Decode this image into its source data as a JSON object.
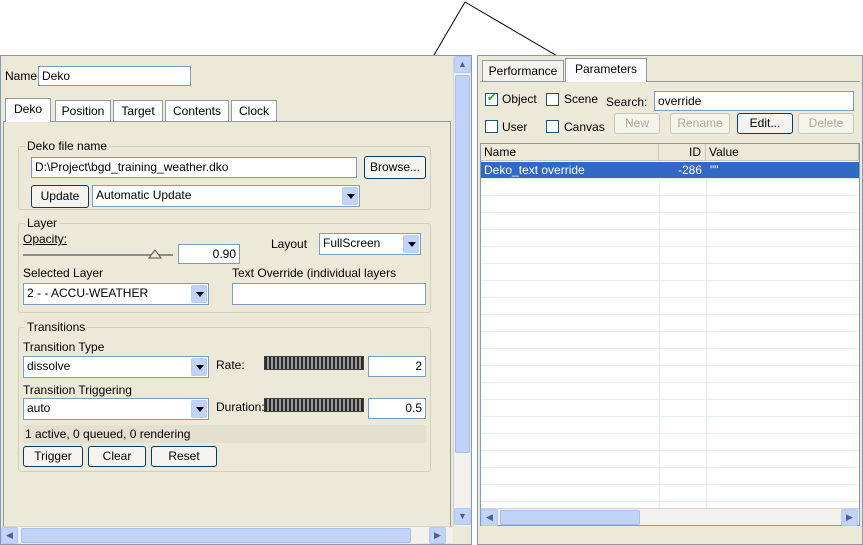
{
  "left": {
    "name_label": "Name:",
    "name_value": "Deko",
    "tabs": [
      "Deko",
      "Position",
      "Target",
      "Contents",
      "Clock"
    ],
    "file_group": {
      "title": "Deko file name",
      "path": "D:\\Project\\bgd_training_weather.dko",
      "browse_label": "Browse...",
      "update_label": "Update",
      "update_mode": "Automatic Update"
    },
    "layer_group": {
      "title": "Layer",
      "opacity_label": "Opacity:",
      "opacity_value": "0.90",
      "layout_label": "Layout",
      "layout_value": "FullScreen",
      "selected_layer_label": "Selected Layer",
      "selected_layer_value": "2 -  - ACCU-WEATHER",
      "text_override_label": "Text Override (individual layers",
      "text_override_value": ""
    },
    "transitions_group": {
      "title": "Transitions",
      "type_label": "Transition Type",
      "type_value": "dissolve",
      "rate_label": "Rate:",
      "rate_value": "2",
      "triggering_label": "Transition Triggering",
      "triggering_value": "auto",
      "duration_label": "Duration:",
      "duration_value": "0.5",
      "status": "1 active, 0 queued, 0 rendering",
      "trigger_label": "Trigger",
      "clear_label": "Clear",
      "reset_label": "Reset"
    }
  },
  "right": {
    "tabs": [
      "Performance",
      "Parameters"
    ],
    "filters": {
      "object_label": "Object",
      "object_checked": true,
      "scene_label": "Scene",
      "scene_checked": false,
      "user_label": "User",
      "user_checked": false,
      "canvas_label": "Canvas",
      "canvas_checked": false,
      "search_label": "Search:",
      "search_value": "override"
    },
    "buttons": {
      "new_label": "New",
      "rename_label": "Rename",
      "edit_label": "Edit...",
      "delete_label": "Delete"
    },
    "grid": {
      "columns": [
        "Name",
        "ID",
        "Value"
      ],
      "rows": [
        {
          "name": "Deko_text override",
          "id": "-286",
          "value": "\"\""
        }
      ]
    }
  },
  "colors": {
    "panel_bg": "#ece9d8",
    "selection": "#316ac5",
    "border": "#7f9db9"
  }
}
